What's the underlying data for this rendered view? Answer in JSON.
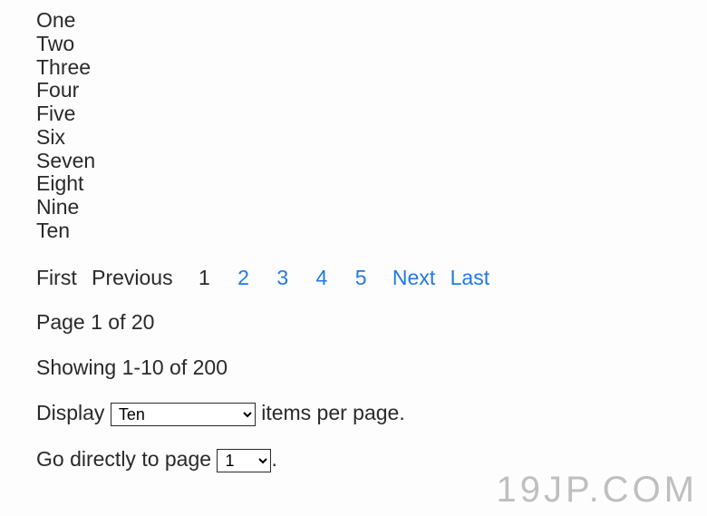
{
  "list_items": [
    "One",
    "Two",
    "Three",
    "Four",
    "Five",
    "Six",
    "Seven",
    "Eight",
    "Nine",
    "Ten"
  ],
  "pager": {
    "first_label": "First",
    "previous_label": "Previous",
    "next_label": "Next",
    "last_label": "Last",
    "pages": [
      "1",
      "2",
      "3",
      "4",
      "5"
    ],
    "current_page_index": 0
  },
  "page_status": {
    "prefix": "Page ",
    "current": "1",
    "of_word": " of ",
    "total": "20"
  },
  "item_status": {
    "prefix": "Showing ",
    "range": "1-10",
    "of_word": " of ",
    "total": "200"
  },
  "display_control": {
    "before": "Display ",
    "selected": "Ten",
    "after": " items per page."
  },
  "goto_control": {
    "before": "Go directly to page ",
    "selected": "1",
    "after": "."
  },
  "watermark": "19JP.COM"
}
